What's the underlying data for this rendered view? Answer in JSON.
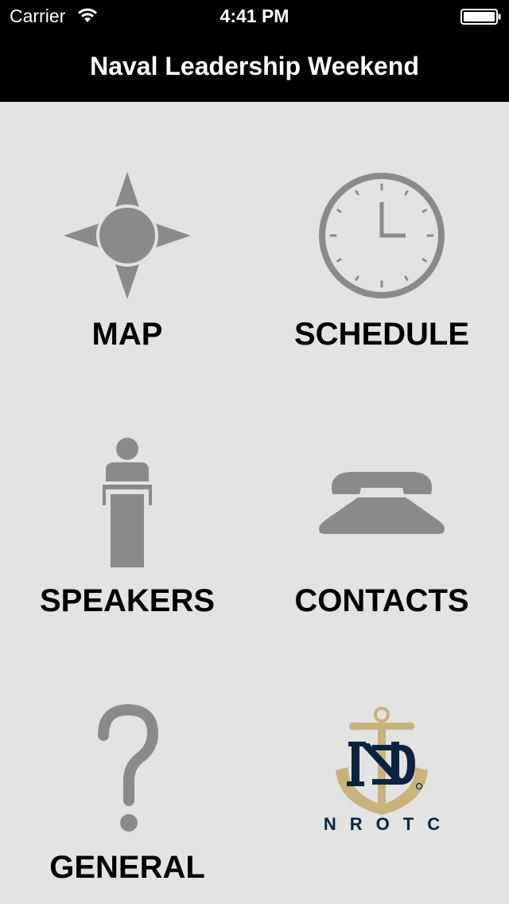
{
  "status_bar": {
    "carrier": "Carrier",
    "time": "4:41 PM",
    "wifi_icon": "wifi-icon",
    "battery_icon": "battery-icon"
  },
  "nav": {
    "title": "Naval Leadership Weekend"
  },
  "menu": [
    {
      "label": "MAP",
      "icon": "compass-icon"
    },
    {
      "label": "SCHEDULE",
      "icon": "clock-icon"
    },
    {
      "label": "SPEAKERS",
      "icon": "podium-icon"
    },
    {
      "label": "CONTACTS",
      "icon": "phone-icon"
    },
    {
      "label": "GENERAL",
      "icon": "question-icon"
    },
    {
      "label": "",
      "icon": "nrotc-logo"
    }
  ],
  "logo": {
    "text": "NROTC",
    "monogram": "ND"
  },
  "colors": {
    "background": "#e3e3e3",
    "bar": "#000000",
    "icon_gray": "#8a8a8c",
    "navy": "#0c2340",
    "gold": "#c9b27c"
  }
}
